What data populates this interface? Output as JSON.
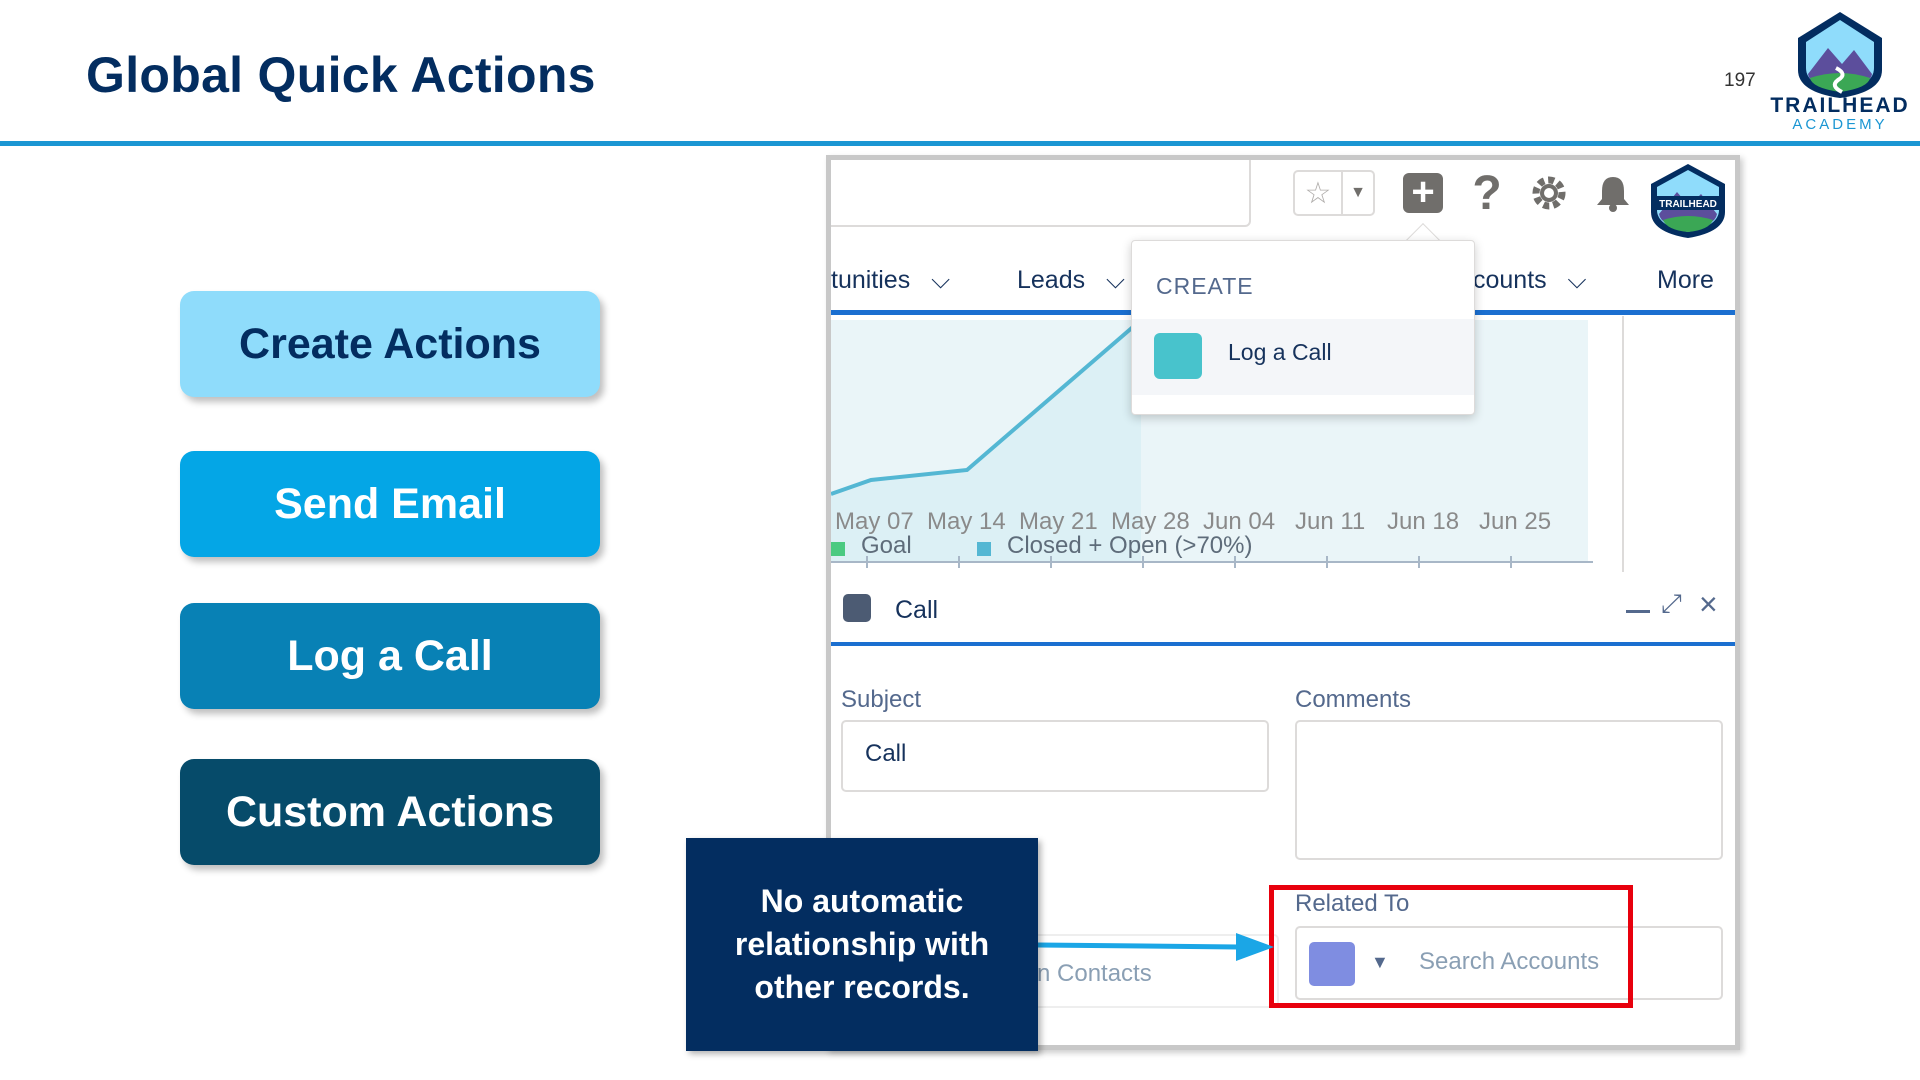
{
  "slide": {
    "title": "Global Quick Actions",
    "page_number": "197",
    "logo_line1": "TRAILHEAD",
    "logo_line2": "ACADEMY"
  },
  "action_buttons": [
    {
      "label": "Create Actions",
      "color": "#8fdcfb"
    },
    {
      "label": "Send Email",
      "color": "#04a6e6"
    },
    {
      "label": "Log a Call",
      "color": "#0881b5"
    },
    {
      "label": "Custom Actions",
      "color": "#064b6a"
    }
  ],
  "screenshot": {
    "utility_icons": [
      "star-icon",
      "chevron-down-icon",
      "add-icon",
      "help-icon",
      "gear-icon",
      "bell-icon",
      "avatar"
    ],
    "avatar_label": "TRAILHEAD",
    "nav": {
      "items": [
        "tunities",
        "Leads",
        "counts",
        "More"
      ]
    },
    "create_menu": {
      "header": "CREATE",
      "items": [
        {
          "label": "Log a Call",
          "icon": "call-log-icon"
        }
      ]
    },
    "chart": {
      "x_labels": [
        "May 07",
        "May 14",
        "May 21",
        "May 28",
        "Jun 04",
        "Jun 11",
        "Jun 18",
        "Jun 25"
      ],
      "legend": [
        {
          "label": "Goal",
          "color": "#4bca81"
        },
        {
          "label": "Closed + Open (>70%)",
          "color": "#54b7d3"
        }
      ]
    },
    "call_panel": {
      "title": "Call",
      "subject_label": "Subject",
      "subject_value": "Call",
      "comments_label": "Comments",
      "name_placeholder_fragment": "n Contacts",
      "related_to_label": "Related To",
      "related_to_placeholder": "Search Accounts"
    }
  },
  "callout": {
    "text": "No automatic relationship with other records."
  },
  "colors": {
    "title": "#032d60",
    "rule": "#1b96d3",
    "highlight": "#e8000d",
    "callout_bg": "#032d60",
    "arrow": "#1ba6e6"
  }
}
